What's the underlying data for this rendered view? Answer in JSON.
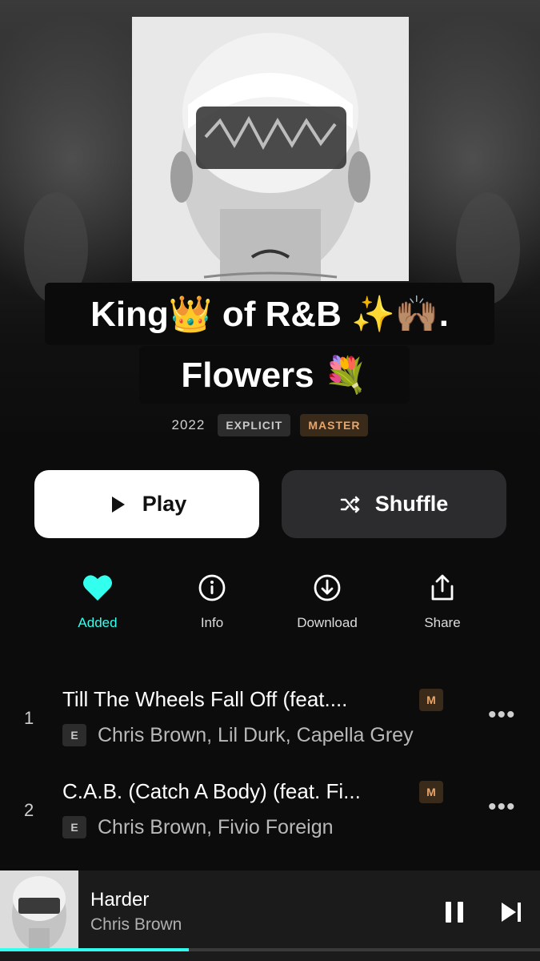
{
  "album": {
    "title_line1": "King👑 of R&B ✨🙌🏽.",
    "title_line2": "Flowers 💐",
    "year": "2022",
    "badge_explicit": "EXPLICIT",
    "badge_master": "MASTER"
  },
  "buttons": {
    "play_label": "Play",
    "shuffle_label": "Shuffle"
  },
  "actions": [
    {
      "label": "Added",
      "icon": "heart-icon",
      "active": true
    },
    {
      "label": "Info",
      "icon": "info-icon"
    },
    {
      "label": "Download",
      "icon": "download-icon"
    },
    {
      "label": "Share",
      "icon": "share-icon"
    }
  ],
  "tracks": [
    {
      "number": "1",
      "title": "Till The Wheels Fall Off (feat....",
      "quality_badge": "M",
      "explicit_badge": "E",
      "artists": "Chris Brown, Lil Durk, Capella Grey",
      "more": "•••"
    },
    {
      "number": "2",
      "title": "C.A.B. (Catch A Body) (feat. Fi...",
      "quality_badge": "M",
      "explicit_badge": "E",
      "artists": "Chris Brown, Fivio Foreign",
      "more": "•••"
    }
  ],
  "now_playing": {
    "title": "Harder",
    "artist": "Chris Brown",
    "progress_fraction": 0.35
  },
  "colors": {
    "accent": "#33ffee",
    "master_badge": "#e7a56a"
  }
}
